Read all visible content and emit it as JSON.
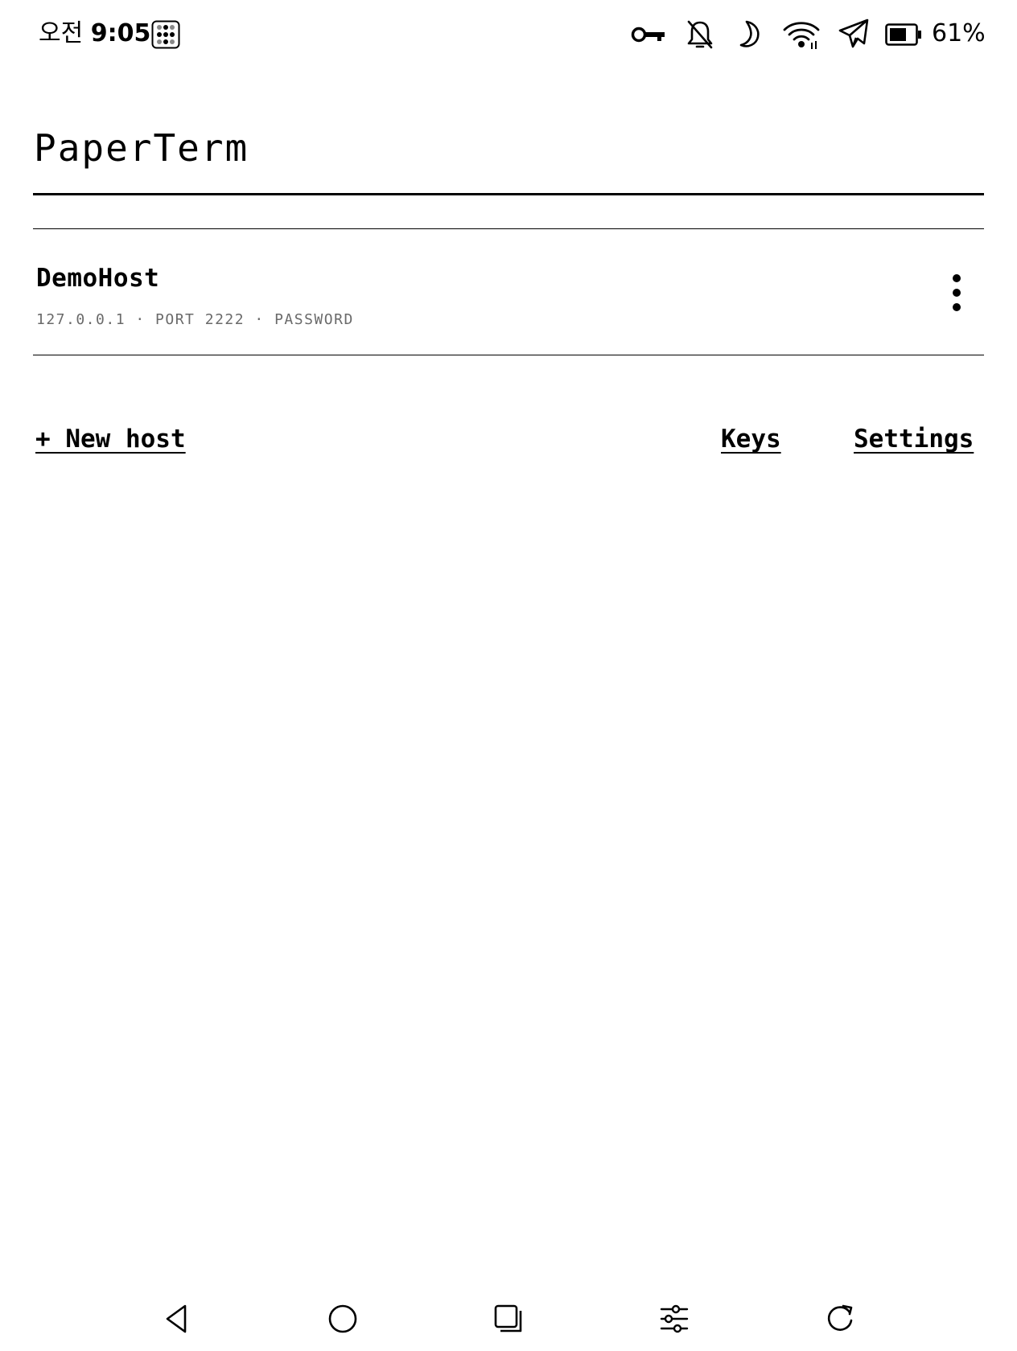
{
  "status_bar": {
    "time_prefix": "오전",
    "time": "9:05",
    "battery_percent": "61%",
    "icons": [
      "app-grid-icon",
      "vpn-key-icon",
      "bell-off-icon",
      "moon-icon",
      "wifi-icon",
      "airplane-icon",
      "battery-icon"
    ]
  },
  "app": {
    "title": "PaperTerm"
  },
  "hosts": [
    {
      "name": "DemoHost",
      "meta": "127.0.0.1 · PORT 2222 · PASSWORD",
      "menu_icon": "more-vertical-icon"
    }
  ],
  "actions": {
    "new_host": "+ New host",
    "keys": "Keys",
    "settings": "Settings"
  },
  "nav": {
    "icons": [
      "back-icon",
      "home-icon",
      "recents-icon",
      "adjust-icon",
      "refresh-icon"
    ]
  },
  "colors": {
    "background": "#ffffff",
    "foreground": "#000000",
    "meta_text": "#6a6a6a"
  }
}
